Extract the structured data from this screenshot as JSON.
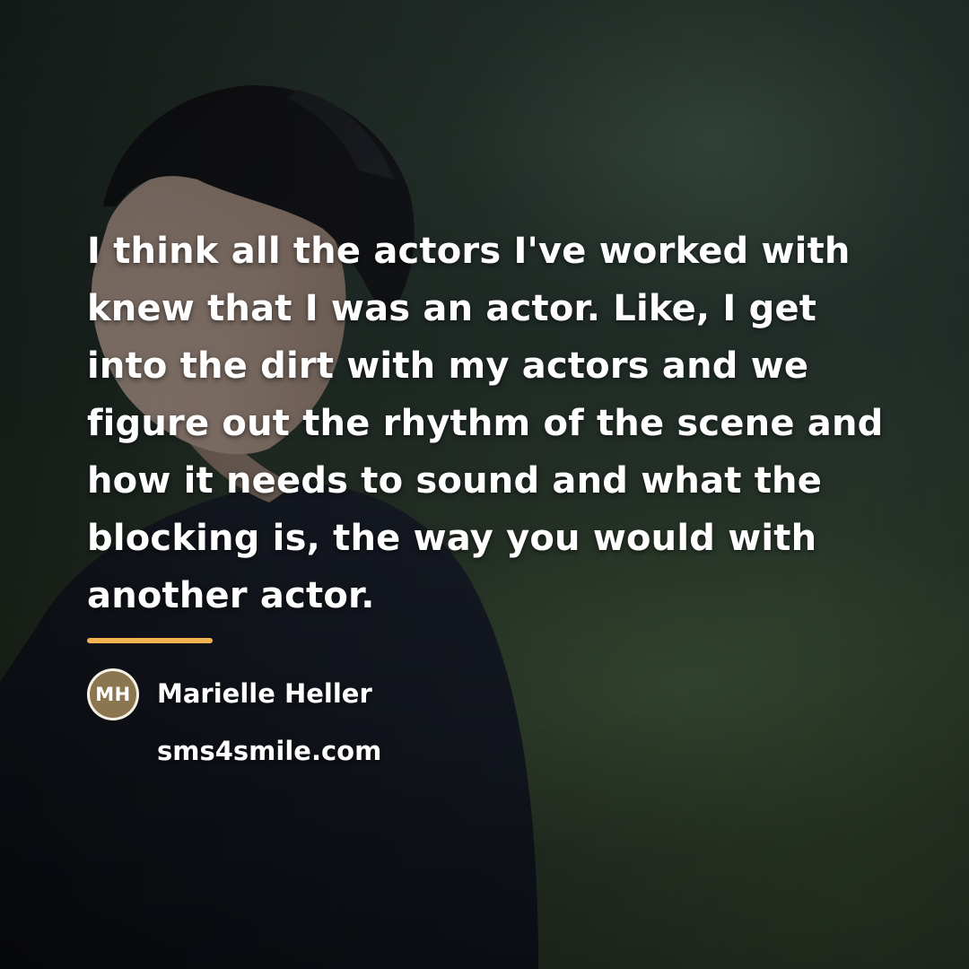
{
  "quote": {
    "text": "I think all the actors I've worked with knew that I was an actor. Like, I get into the dirt with my actors and we figure out the rhythm of the scene and how it needs to sound and what the blocking is, the way you would with another actor."
  },
  "author": {
    "initials": "MH",
    "name": "Marielle Heller"
  },
  "site": {
    "url": "sms4smile.com"
  },
  "colors": {
    "accent": "#f0b350",
    "avatar_fill": "#8c7650",
    "text": "#ffffff"
  }
}
